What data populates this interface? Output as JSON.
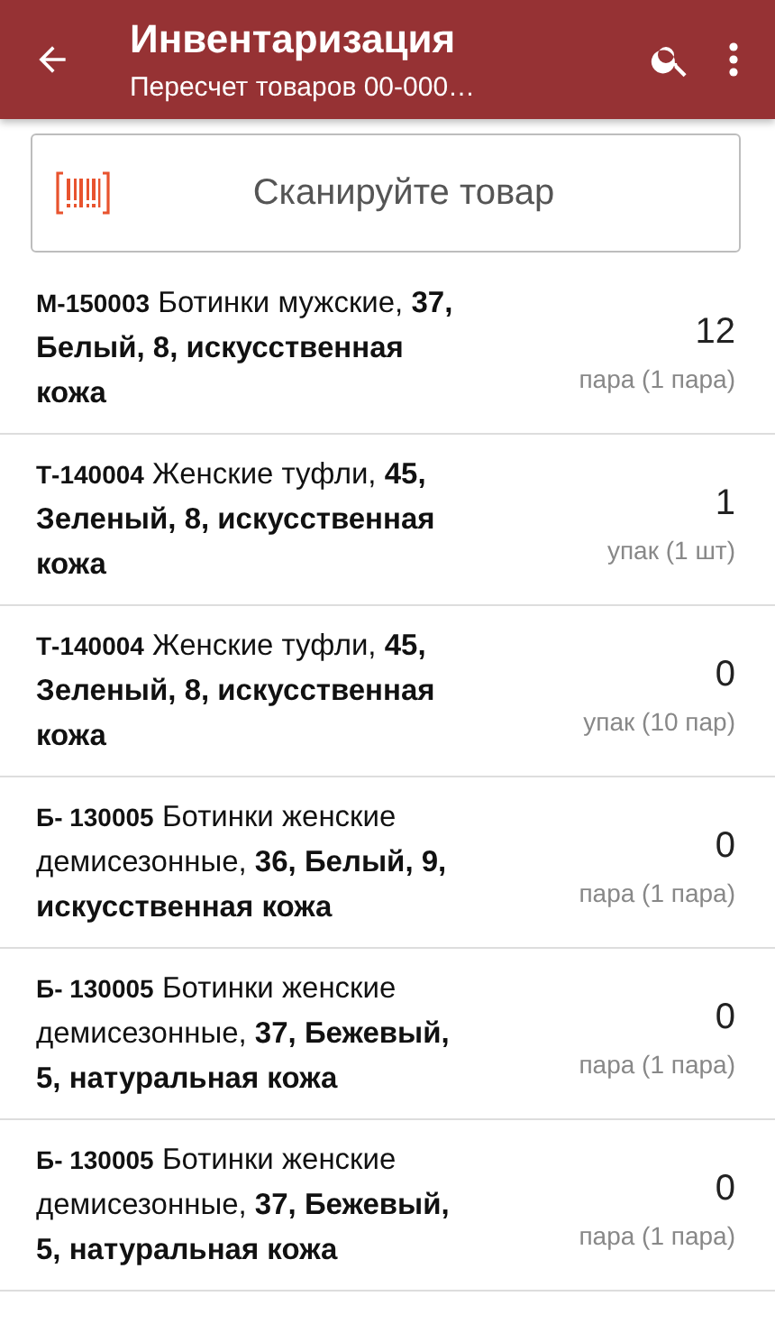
{
  "app_bar": {
    "title": "Инвентаризация",
    "subtitle": "Пересчет товаров 00-000…"
  },
  "scan_field": {
    "placeholder": "Сканируйте товар"
  },
  "items": [
    {
      "code": "М-150003",
      "description": "Ботинки мужские, **37, Белый, 8, искусственная кожа**",
      "quantity": "12",
      "unit": "пара (1 пара)"
    },
    {
      "code": "Т-140004",
      "description": "Женские туфли, **45, Зеленый, 8, искусственная кожа**",
      "quantity": "1",
      "unit": "упак (1 шт)"
    },
    {
      "code": "Т-140004",
      "description": "Женские туфли, **45, Зеленый, 8, искусственная кожа**",
      "quantity": "0",
      "unit": "упак (10 пар)"
    },
    {
      "code": "Б- 130005",
      "description": "Ботинки женские демисезонные, **36, Белый, 9, искусственная кожа**",
      "quantity": "0",
      "unit": "пара (1 пара)"
    },
    {
      "code": "Б- 130005",
      "description": "Ботинки женские демисезонные, **37, Бежевый, 5, натуральная кожа**",
      "quantity": "0",
      "unit": "пара (1 пара)"
    },
    {
      "code": "Б- 130005",
      "description": "Ботинки женские демисезонные, **37, Бежевый, 5, натуральная кожа**",
      "quantity": "0",
      "unit": "пара (1 пара)"
    }
  ]
}
